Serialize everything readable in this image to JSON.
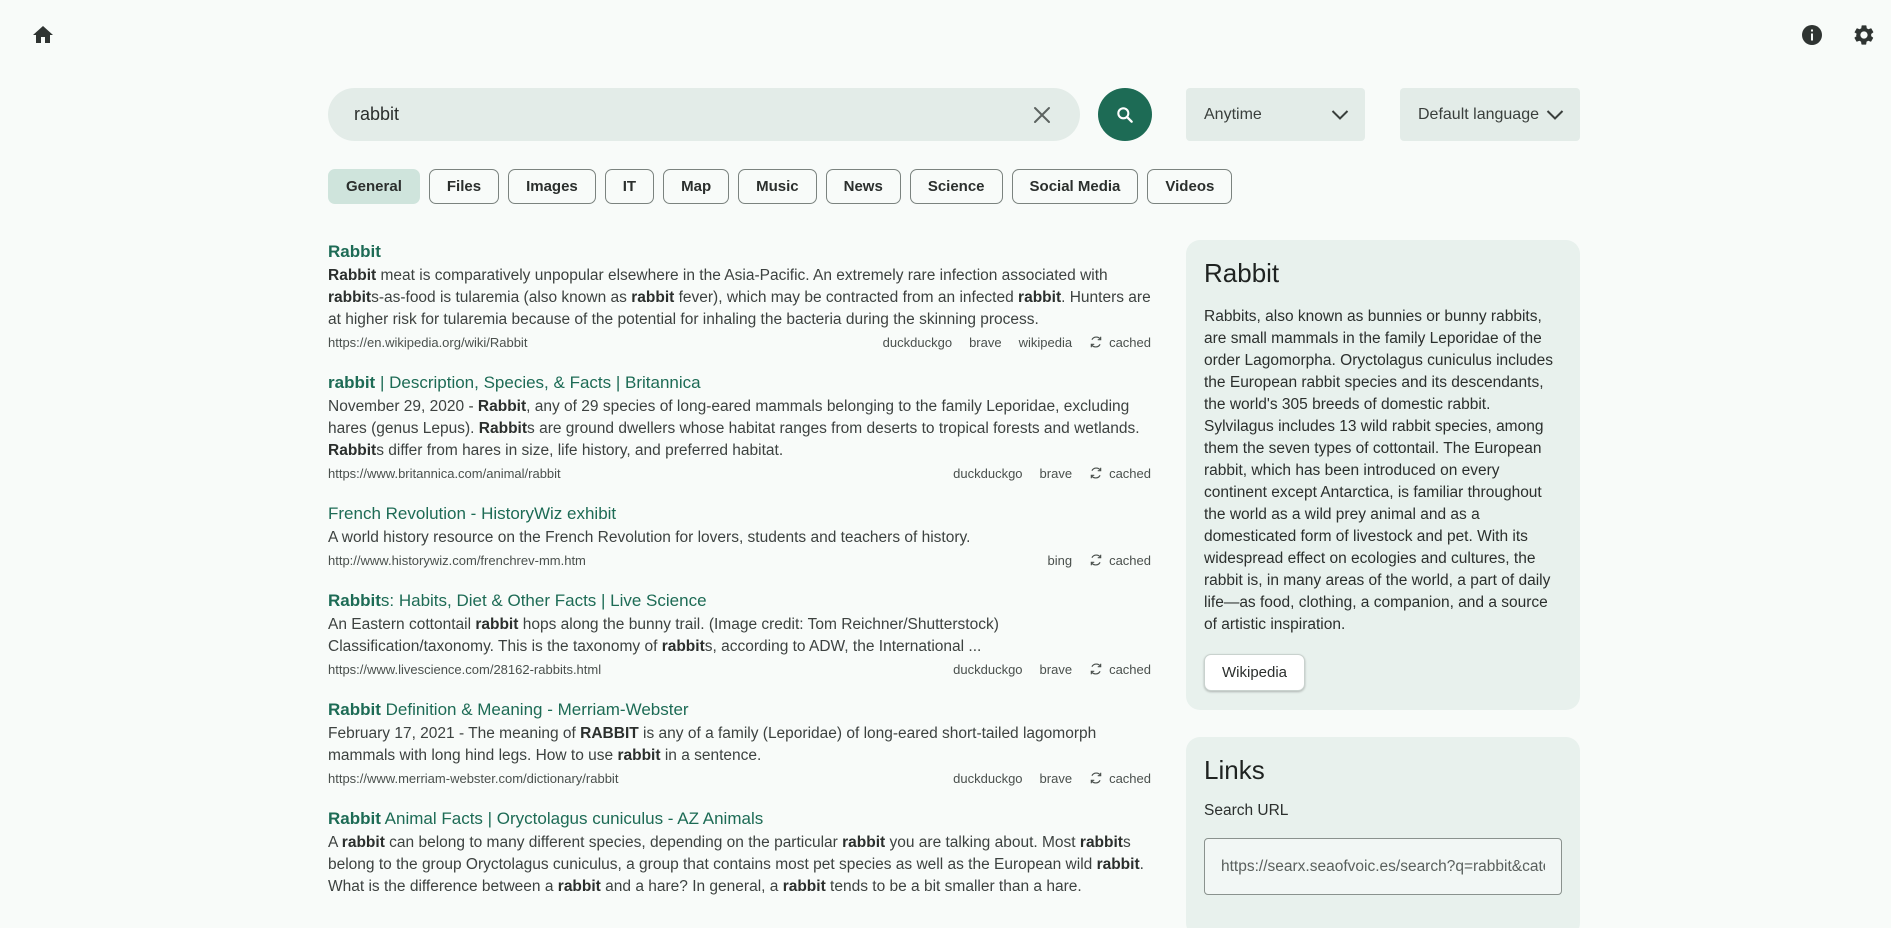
{
  "search": {
    "query": "rabbit"
  },
  "filters": {
    "time": "Anytime",
    "language": "Default language"
  },
  "tabs": [
    "General",
    "Files",
    "Images",
    "IT",
    "Map",
    "Music",
    "News",
    "Science",
    "Social Media",
    "Videos"
  ],
  "active_tab": "General",
  "cached_label": "cached",
  "results": [
    {
      "title_html": "<b>Rabbit</b>",
      "snippet_html": "<b>Rabbit</b> meat is comparatively unpopular elsewhere in the Asia-Pacific. An extremely rare infection associated with <b>rabbit</b>s-as-food is tularemia (also known as <b>rabbit</b> fever), which may be contracted from an infected <b>rabbit</b>. Hunters are at higher risk for tularemia because of the potential for inhaling the bacteria during the skinning process.",
      "url": "https://en.wikipedia.org/wiki/Rabbit",
      "engines": [
        "duckduckgo",
        "brave",
        "wikipedia"
      ]
    },
    {
      "title_html": "<b>rabbit</b> | Description, Species, &amp; Facts | Britannica",
      "snippet_html": "November 29, 2020 - <b>Rabbit</b>, any of 29 species of long-eared mammals belonging to the family Leporidae, excluding hares (genus Lepus). <b>Rabbit</b>s are ground dwellers whose habitat ranges from deserts to tropical forests and wetlands. <b>Rabbit</b>s differ from hares in size, life history, and preferred habitat.",
      "url": "https://www.britannica.com/animal/rabbit",
      "engines": [
        "duckduckgo",
        "brave"
      ]
    },
    {
      "title_html": "French Revolution - HistoryWiz exhibit",
      "snippet_html": "A world history resource on the French Revolution for lovers, students and teachers of history.",
      "url": "http://www.historywiz.com/frenchrev-mm.htm",
      "engines": [
        "bing"
      ]
    },
    {
      "title_html": "<b>Rabbit</b>s: Habits, Diet &amp; Other Facts | Live Science",
      "snippet_html": "An Eastern cottontail <b>rabbit</b> hops along the bunny trail. (Image credit: Tom Reichner/Shutterstock) Classification/taxonomy. This is the taxonomy of <b>rabbit</b>s, according to ADW, the International ...",
      "url": "https://www.livescience.com/28162-rabbits.html",
      "engines": [
        "duckduckgo",
        "brave"
      ]
    },
    {
      "title_html": "<b>Rabbit</b> Definition &amp; Meaning - Merriam-Webster",
      "snippet_html": "February 17, 2021 - The meaning of <b>RABBIT</b> is any of a family (Leporidae) of long-eared short-tailed lagomorph mammals with long hind legs. How to use <b>rabbit</b> in a sentence.",
      "url": "https://www.merriam-webster.com/dictionary/rabbit",
      "engines": [
        "duckduckgo",
        "brave"
      ]
    },
    {
      "title_html": "<b>Rabbit</b> Animal Facts | Oryctolagus cuniculus - AZ Animals",
      "snippet_html": "A <b>rabbit</b> can belong to many different species, depending on the particular <b>rabbit</b> you are talking about. Most <b>rabbit</b>s belong to the group Oryctolagus cuniculus, a group that contains most pet species as well as the European wild <b>rabbit</b>. What is the difference between a <b>rabbit</b> and a hare? In general, a <b>rabbit</b> tends to be a bit smaller than a hare.",
      "url": "",
      "engines": []
    }
  ],
  "infobox": {
    "title": "Rabbit",
    "description": "Rabbits, also known as bunnies or bunny rabbits, are small mammals in the family Leporidae of the order Lagomorpha. Oryctolagus cuniculus includes the European rabbit species and its descendants, the world's 305 breeds of domestic rabbit. Sylvilagus includes 13 wild rabbit species, among them the seven types of cottontail. The European rabbit, which has been introduced on every continent except Antarctica, is familiar throughout the world as a wild prey animal and as a domesticated form of livestock and pet. With its widespread effect on ecologies and cultures, the rabbit is, in many areas of the world, a part of daily life—as food, clothing, a companion, and a source of artistic inspiration.",
    "button": "Wikipedia"
  },
  "links": {
    "title": "Links",
    "label": "Search URL",
    "url": "https://searx.seaofvoic.es/search?q=rabbit&categories=general"
  }
}
